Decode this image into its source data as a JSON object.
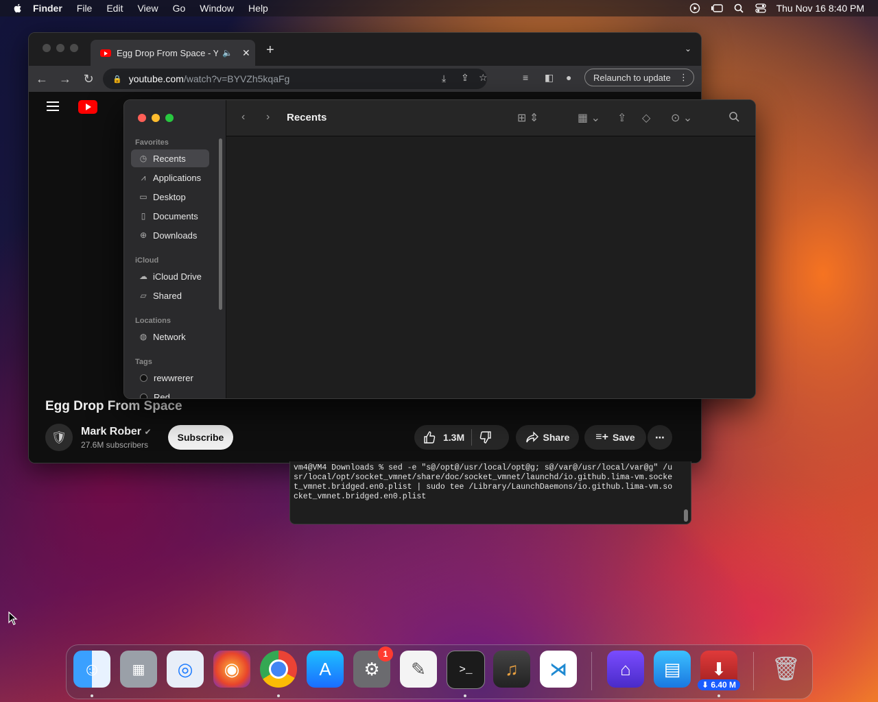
{
  "menubar": {
    "app": "Finder",
    "items": [
      "File",
      "Edit",
      "View",
      "Go",
      "Window",
      "Help"
    ],
    "clock": "Thu Nov 16  8:40 PM"
  },
  "chrome": {
    "tab_title": "Egg Drop From Space - Yo",
    "url_host": "youtube.com",
    "url_path": "/watch?v=BYVZh5kqaFg",
    "relaunch_label": "Relaunch to update"
  },
  "youtube": {
    "video_title": "Egg Drop From Space",
    "channel_name": "Mark Rober",
    "subscribers": "27.6M subscribers",
    "subscribe_label": "Subscribe",
    "likes": "1.3M",
    "share_label": "Share",
    "save_label": "Save"
  },
  "finder": {
    "title": "Recents",
    "sections": {
      "favorites": "Favorites",
      "icloud": "iCloud",
      "locations": "Locations",
      "tags": "Tags"
    },
    "favorites": [
      "Recents",
      "Applications",
      "Desktop",
      "Documents",
      "Downloads"
    ],
    "icloud": [
      "iCloud Drive",
      "Shared"
    ],
    "locations": [
      "Network"
    ],
    "tags": [
      "rewwrerer",
      "Red"
    ]
  },
  "terminal": {
    "lines": [
      "vm4@VM4 Downloads % sed -e \"s@/opt@/usr/local/opt@g; s@/var@/usr/local/var@g\" /u",
      "sr/local/opt/socket_vmnet/share/doc/socket_vmnet/launchd/io.github.lima-vm.socke",
      "t_vmnet.bridged.en0.plist | sudo tee /Library/LaunchDaemons/io.github.lima-vm.so",
      "cket_vmnet.bridged.en0.plist"
    ]
  },
  "dock": {
    "settings_badge": "1",
    "download_badge": "⬇ 6.40 M",
    "apps": [
      "finder",
      "launchpad",
      "safari",
      "firefox",
      "chrome",
      "app-store",
      "system-settings",
      "textedit",
      "terminal",
      "garageband",
      "vscode",
      "apple-configurator",
      "keynote",
      "downloader",
      "trash"
    ]
  }
}
